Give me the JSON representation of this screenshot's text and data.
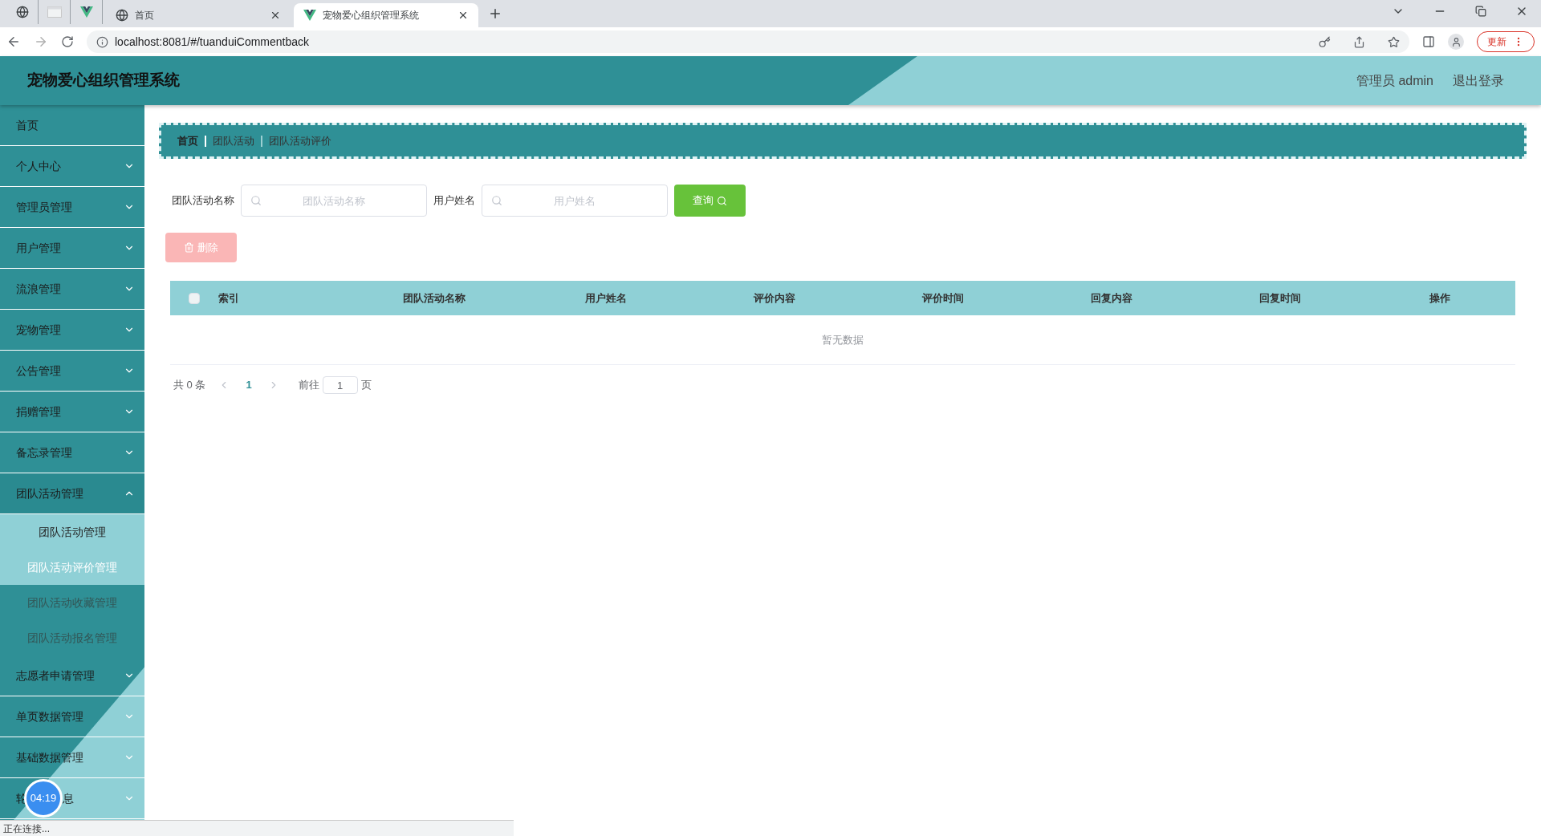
{
  "browser": {
    "tabs": [
      {
        "kind": "pinned",
        "selected": false
      },
      {
        "kind": "pinned",
        "selected": false
      },
      {
        "kind": "pinned",
        "selected": false
      },
      {
        "kind": "titled",
        "title": "首页",
        "selected": false
      },
      {
        "kind": "titled",
        "title": "宠物爱心组织管理系统",
        "selected": true
      }
    ],
    "url": "localhost:8081/#/tuanduiCommentback",
    "update_button": "更新"
  },
  "header": {
    "title": "宠物爱心组织管理系统",
    "user": "管理员 admin",
    "logout": "退出登录"
  },
  "sidebar": {
    "items": [
      {
        "kind": "link",
        "label": "首页"
      },
      {
        "kind": "menu",
        "label": "个人中心",
        "expanded": false
      },
      {
        "kind": "menu",
        "label": "管理员管理",
        "expanded": false
      },
      {
        "kind": "menu",
        "label": "用户管理",
        "expanded": false
      },
      {
        "kind": "menu",
        "label": "流浪管理",
        "expanded": false
      },
      {
        "kind": "menu",
        "label": "宠物管理",
        "expanded": false
      },
      {
        "kind": "menu",
        "label": "公告管理",
        "expanded": false
      },
      {
        "kind": "menu",
        "label": "捐赠管理",
        "expanded": false
      },
      {
        "kind": "menu",
        "label": "备忘录管理",
        "expanded": false
      },
      {
        "kind": "menu",
        "label": "团队活动管理",
        "expanded": true,
        "children": [
          {
            "label": "团队活动管理",
            "highlighted": true,
            "selected": false
          },
          {
            "label": "团队活动评价管理",
            "highlighted": true,
            "selected": true
          },
          {
            "label": "团队活动收藏管理",
            "highlighted": false,
            "selected": false
          },
          {
            "label": "团队活动报名管理",
            "highlighted": false,
            "selected": false
          }
        ]
      },
      {
        "kind": "menu",
        "label": "志愿者申请管理",
        "expanded": false
      },
      {
        "kind": "menu",
        "label": "单页数据管理",
        "expanded": false
      },
      {
        "kind": "menu",
        "label": "基础数据管理",
        "expanded": false
      },
      {
        "kind": "menu",
        "label": "轮",
        "label_end": "息",
        "expanded": false
      }
    ]
  },
  "breadcrumb": [
    "首页",
    "团队活动",
    "团队活动评价"
  ],
  "search": {
    "fields": [
      {
        "label": "团队活动名称",
        "placeholder": "团队活动名称"
      },
      {
        "label": "用户姓名",
        "placeholder": "用户姓名"
      }
    ],
    "query_button": "查询"
  },
  "delete_button": {
    "label": "删除",
    "disabled": true
  },
  "table": {
    "select_all_checked": false,
    "columns": [
      "索引",
      "团队活动名称",
      "用户姓名",
      "评价内容",
      "评价时间",
      "回复内容",
      "回复时间",
      "操作"
    ],
    "empty_text": "暂无数据"
  },
  "pagination": {
    "total": "共 0 条",
    "current": "1",
    "goto_label": "前往",
    "goto_value": "1",
    "page_suffix": "页"
  },
  "recorder_timer": "04:19",
  "status_bar": "正在连接..."
}
